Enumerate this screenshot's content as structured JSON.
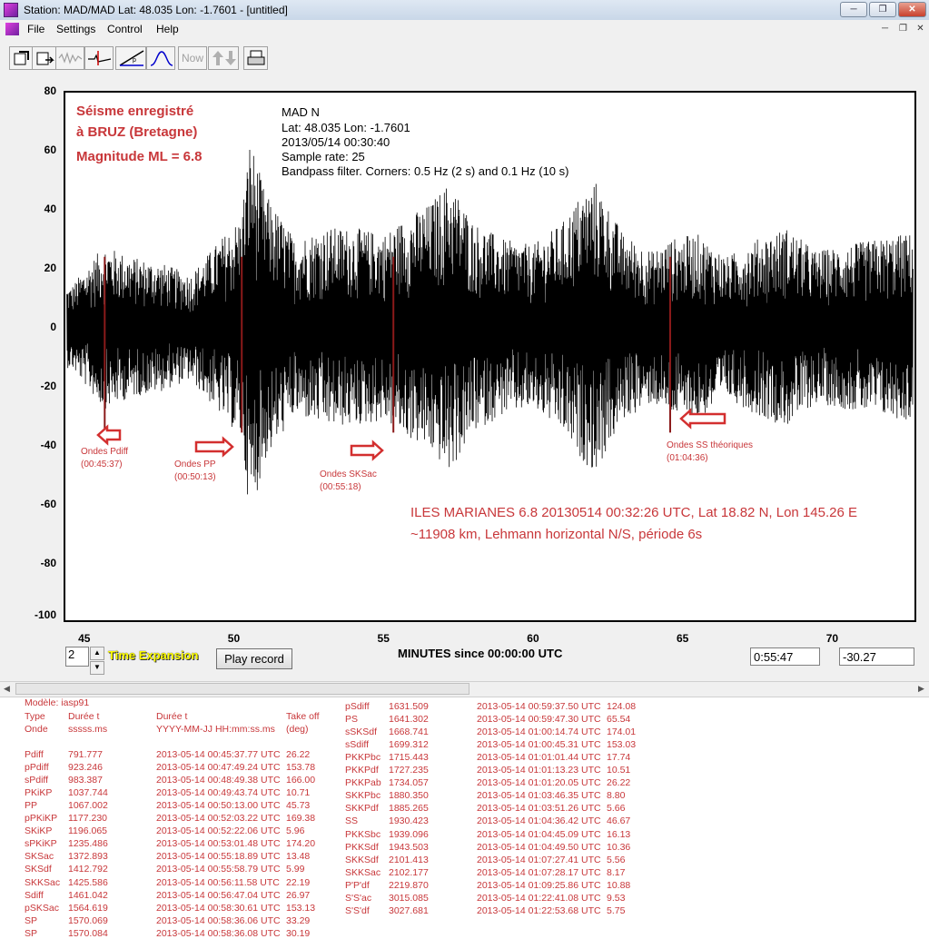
{
  "window": {
    "title": "Station: MAD/MAD Lat: 48.035 Lon: -1.7601 - [untitled]",
    "buttons": [
      "─",
      "❐",
      "✕"
    ]
  },
  "menu": {
    "items": [
      "File",
      "Settings",
      "Control",
      "Help"
    ]
  },
  "toolbar": {
    "now_label": "Now"
  },
  "plot": {
    "info_lines": [
      "MAD  N",
      "Lat: 48.035 Lon: -1.7601",
      "2013/05/14 00:30:40",
      "Sample rate: 25",
      "Bandpass filter. Corners: 0.5 Hz (2 s) and 0.1 Hz (10 s)"
    ],
    "title_red": [
      "Séisme enregistré",
      "à BRUZ (Bretagne)",
      "Magnitude ML = 6.8"
    ],
    "event_line1": "ILES MARIANES 6.8 20130514 00:32:26 UTC, Lat 18.82 N, Lon 145.26 E",
    "event_line2": "~11908 km, Lehmann horizontal N/S, période 6s",
    "xlabel": "MINUTES since 00:00:00 UTC",
    "yticks": [
      "80",
      "60",
      "40",
      "20",
      "0",
      "-20",
      "-40",
      "-60",
      "-80",
      "-100"
    ],
    "xticks": [
      "45",
      "50",
      "55",
      "60",
      "65",
      "70"
    ],
    "annotations": [
      {
        "line1": "Ondes Pdiff",
        "line2": "(00:45:37)"
      },
      {
        "line1": "Ondes PP",
        "line2": "(00:50:13)"
      },
      {
        "line1": "Ondes SKSac",
        "line2": "(00:55:18)"
      },
      {
        "line1": "Ondes SS théoriques",
        "line2": "(01:04:36)"
      }
    ]
  },
  "chart_data": {
    "type": "line",
    "xlabel": "MINUTES since 00:00:00 UTC",
    "ylabel": "",
    "xlim": [
      44.3,
      72.8
    ],
    "ylim": [
      -100,
      80
    ],
    "series": [
      {
        "values": []
      }
    ],
    "picks": [
      {
        "name": "Pdiff",
        "x": 45.62
      },
      {
        "name": "PP",
        "x": 50.22
      },
      {
        "name": "SKSac",
        "x": 55.31
      },
      {
        "name": "SS",
        "x": 64.6
      }
    ],
    "approx_envelope": [
      [
        44.5,
        14
      ],
      [
        45.6,
        28
      ],
      [
        46.5,
        24
      ],
      [
        47.5,
        22
      ],
      [
        48.5,
        18
      ],
      [
        49.5,
        30
      ],
      [
        50.2,
        38
      ],
      [
        50.5,
        65
      ],
      [
        51,
        46
      ],
      [
        52,
        30
      ],
      [
        53,
        34
      ],
      [
        54,
        34
      ],
      [
        55,
        32
      ],
      [
        55.8,
        38
      ],
      [
        56.5,
        42
      ],
      [
        57.2,
        50
      ],
      [
        58,
        36
      ],
      [
        59,
        30
      ],
      [
        60,
        28
      ],
      [
        61,
        36
      ],
      [
        61.5,
        44
      ],
      [
        62.1,
        50
      ],
      [
        63,
        32
      ],
      [
        64,
        26
      ],
      [
        64.6,
        30
      ],
      [
        65.5,
        32
      ],
      [
        66.5,
        24
      ],
      [
        67.5,
        30
      ],
      [
        68.5,
        34
      ],
      [
        69.5,
        26
      ],
      [
        70.5,
        28
      ],
      [
        71.5,
        30
      ],
      [
        72.5,
        32
      ]
    ]
  },
  "controls": {
    "spin_value": "2",
    "time_expansion": "Time Expansion",
    "play_button": "Play record",
    "time_readout": "0:55:47",
    "amp_readout": "-30.27"
  },
  "table": {
    "model": "Modèle: iasp91",
    "headers": {
      "type1": "Type",
      "type2": "Onde",
      "dur1": "Durée t",
      "dur2": "sssss.ms",
      "date1": "Durée t",
      "date2": "YYYY-MM-JJ HH:mm:ss.ms",
      "take1": "Take off",
      "take2": "(deg)"
    },
    "left_rows": [
      [
        "Pdiff",
        "791.777",
        "2013-05-14 00:45:37.77 UTC",
        "26.22"
      ],
      [
        "pPdiff",
        "923.246",
        "2013-05-14 00:47:49.24 UTC",
        "153.78"
      ],
      [
        "sPdiff",
        "983.387",
        "2013-05-14 00:48:49.38 UTC",
        "166.00"
      ],
      [
        "PKiKP",
        "1037.744",
        "2013-05-14 00:49:43.74 UTC",
        "10.71"
      ],
      [
        "PP",
        "1067.002",
        "2013-05-14 00:50:13.00 UTC",
        "45.73"
      ],
      [
        "pPKiKP",
        "1177.230",
        "2013-05-14 00:52:03.22 UTC",
        "169.38"
      ],
      [
        "SKiKP",
        "1196.065",
        "2013-05-14 00:52:22.06 UTC",
        "5.96"
      ],
      [
        "sPKiKP",
        "1235.486",
        "2013-05-14 00:53:01.48 UTC",
        "174.20"
      ],
      [
        "SKSac",
        "1372.893",
        "2013-05-14 00:55:18.89 UTC",
        "13.48"
      ],
      [
        "SKSdf",
        "1412.792",
        "2013-05-14 00:55:58.79 UTC",
        "5.99"
      ],
      [
        "SKKSac",
        "1425.586",
        "2013-05-14 00:56:11.58 UTC",
        "22.19"
      ],
      [
        "Sdiff",
        "1461.042",
        "2013-05-14 00:56:47.04 UTC",
        "26.97"
      ],
      [
        "pSKSac",
        "1564.619",
        "2013-05-14 00:58:30.61 UTC",
        "153.13"
      ],
      [
        "SP",
        "1570.069",
        "2013-05-14 00:58:36.06 UTC",
        "33.29"
      ],
      [
        "SP",
        "1570.084",
        "2013-05-14 00:58:36.08 UTC",
        "30.19"
      ]
    ],
    "right_rows": [
      [
        "pSdiff",
        "1631.509",
        "2013-05-14 00:59:37.50 UTC",
        "124.08"
      ],
      [
        "PS",
        "1641.302",
        "2013-05-14 00:59:47.30 UTC",
        "65.54"
      ],
      [
        "sSKSdf",
        "1668.741",
        "2013-05-14 01:00:14.74 UTC",
        "174.01"
      ],
      [
        "sSdiff",
        "1699.312",
        "2013-05-14 01:00:45.31 UTC",
        "153.03"
      ],
      [
        "PKKPbc",
        "1715.443",
        "2013-05-14 01:01:01.44 UTC",
        "17.74"
      ],
      [
        "PKKPdf",
        "1727.235",
        "2013-05-14 01:01:13.23 UTC",
        "10.51"
      ],
      [
        "PKKPab",
        "1734.057",
        "2013-05-14 01:01:20.05 UTC",
        "26.22"
      ],
      [
        "SKKPbc",
        "1880.350",
        "2013-05-14 01:03:46.35 UTC",
        "8.80"
      ],
      [
        "SKKPdf",
        "1885.265",
        "2013-05-14 01:03:51.26 UTC",
        "5.66"
      ],
      [
        "SS",
        "1930.423",
        "2013-05-14 01:04:36.42 UTC",
        "46.67"
      ],
      [
        "PKKSbc",
        "1939.096",
        "2013-05-14 01:04:45.09 UTC",
        "16.13"
      ],
      [
        "PKKSdf",
        "1943.503",
        "2013-05-14 01:04:49.50 UTC",
        "10.36"
      ],
      [
        "SKKSdf",
        "2101.413",
        "2013-05-14 01:07:27.41 UTC",
        "5.56"
      ],
      [
        "SKKSac",
        "2102.177",
        "2013-05-14 01:07:28.17 UTC",
        "8.17"
      ],
      [
        "P'P'df",
        "2219.870",
        "2013-05-14 01:09:25.86 UTC",
        "10.88"
      ],
      [
        "S'S'ac",
        "3015.085",
        "2013-05-14 01:22:41.08 UTC",
        "9.53"
      ],
      [
        "S'S'df",
        "3027.681",
        "2013-05-14 01:22:53.68 UTC",
        "5.75"
      ]
    ]
  },
  "colors": {
    "annotation_red": "#c8373a",
    "pick_line": "#8b1a1a",
    "time_expansion": "#ffff00"
  }
}
